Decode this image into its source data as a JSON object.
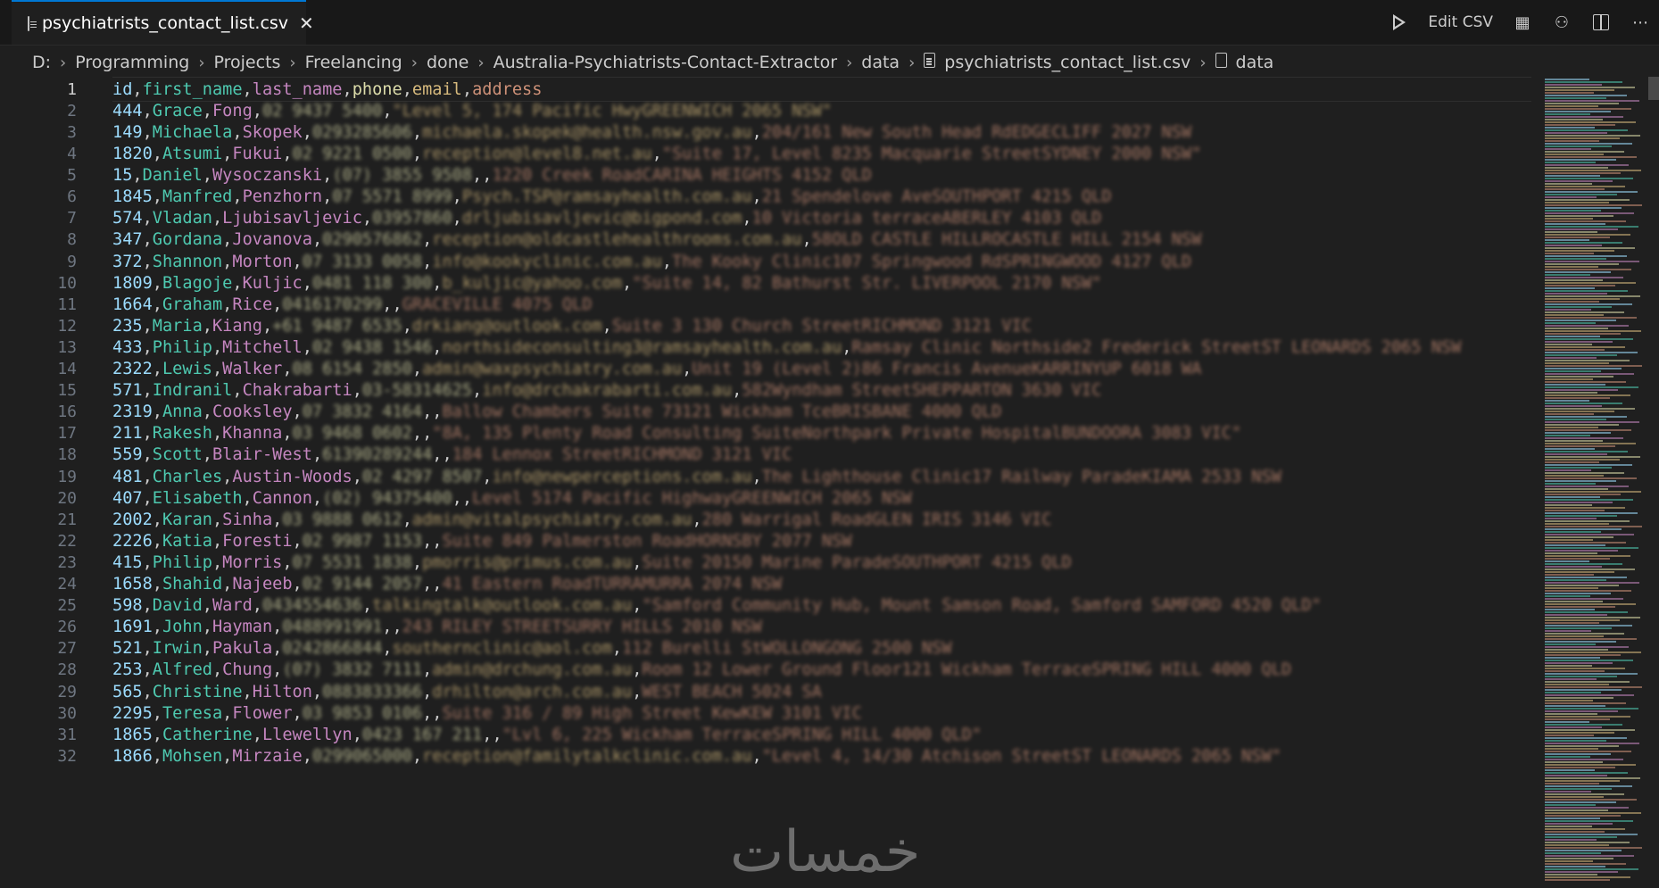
{
  "tab": {
    "title": "psychiatrists_contact_list.csv",
    "close": "✕"
  },
  "toolbar": {
    "edit_csv": "Edit CSV"
  },
  "breadcrumb": [
    "D:",
    "Programming",
    "Projects",
    "Freelancing",
    "done",
    "Australia-Psychiatrists-Contact-Extractor",
    "data",
    "psychiatrists_contact_list.csv",
    "data"
  ],
  "lines": [
    {
      "n": "1",
      "fields": [
        "id",
        "first_name",
        "last_name",
        "phone",
        "email",
        "address"
      ]
    },
    {
      "n": "2",
      "fields": [
        "444",
        "Grace",
        "Fong",
        "02 9437 5400",
        "\"Level 5, 174 Pacific HwyGREENWICH 2065 NSW\""
      ]
    },
    {
      "n": "3",
      "fields": [
        "149",
        "Michaela",
        "Skopek",
        "0293285606",
        "michaela.skopek@health.nsw.gov.au",
        "204/161 New South Head RdEDGECLIFF 2027 NSW"
      ]
    },
    {
      "n": "4",
      "fields": [
        "1820",
        "Atsumi",
        "Fukui",
        "02 9221 0500",
        "reception@level8.net.au",
        "\"Suite 17, Level 8235 Macquarie StreetSYDNEY 2000 NSW\""
      ]
    },
    {
      "n": "5",
      "fields": [
        "15",
        "Daniel",
        "Wysoczanski",
        "(07) 3855 9508",
        "",
        "1220 Creek RoadCARINA HEIGHTS 4152 QLD"
      ]
    },
    {
      "n": "6",
      "fields": [
        "1845",
        "Manfred",
        "Penzhorn",
        "07 5571 8999",
        "Psych.TSP@ramsayhealth.com.au",
        "21 Spendelove AveSOUTHPORT 4215 QLD"
      ]
    },
    {
      "n": "7",
      "fields": [
        "574",
        "Vladan",
        "Ljubisavljevic",
        "03957860",
        "drljubisavljevic@bigpond.com",
        "10 Victoria terraceABERLEY 4103 QLD"
      ]
    },
    {
      "n": "8",
      "fields": [
        "347",
        "Gordana",
        "Jovanova",
        "0290576862",
        "reception@oldcastlehealthrooms.com.au",
        "58OLD CASTLE HILLROCASTLE HILL 2154 NSW"
      ]
    },
    {
      "n": "9",
      "fields": [
        "372",
        "Shannon",
        "Morton",
        "07 3133 0058",
        "info@kookyclinic.com.au",
        "The Kooky Clinic107 Springwood RdSPRINGWOOD 4127 QLD"
      ]
    },
    {
      "n": "10",
      "fields": [
        "1809",
        "Blagoje",
        "Kuljic",
        "0481 118 300",
        "b_kuljic@yahoo.com",
        "\"Suite 14, 82 Bathurst Str. LIVERPOOL 2170 NSW\""
      ]
    },
    {
      "n": "11",
      "fields": [
        "1664",
        "Graham",
        "Rice",
        "0416170299",
        "",
        "GRACEVILLE 4075 QLD"
      ]
    },
    {
      "n": "12",
      "fields": [
        "235",
        "Maria",
        "Kiang",
        "+61 9487 6535",
        "drkiang@outlook.com",
        "Suite 3 130 Church StreetRICHMOND 3121 VIC"
      ]
    },
    {
      "n": "13",
      "fields": [
        "433",
        "Philip",
        "Mitchell",
        "02 9438 1546",
        "northsideconsulting3@ramsayhealth.com.au",
        "Ramsay Clinic Northside2 Frederick StreetST LEONARDS 2065 NSW"
      ]
    },
    {
      "n": "14",
      "fields": [
        "2322",
        "Lewis",
        "Walker",
        "08 6154 2850",
        "admin@waxpsychiatry.com.au",
        "Unit 19 (Level 2)86 Francis AvenueKARRINYUP 6018 WA"
      ]
    },
    {
      "n": "15",
      "fields": [
        "571",
        "Indranil",
        "Chakrabarti",
        "03-58314625",
        "info@drchakrabarti.com.au",
        "582Wyndham StreetSHEPPARTON 3630 VIC"
      ]
    },
    {
      "n": "16",
      "fields": [
        "2319",
        "Anna",
        "Cooksley",
        "07 3832 4164",
        "",
        "Ballow Chambers Suite 73121 Wickham TceBRISBANE 4000 QLD"
      ]
    },
    {
      "n": "17",
      "fields": [
        "211",
        "Rakesh",
        "Khanna",
        "03 9468 0602",
        "",
        "\"8A, 135 Plenty Road Consulting SuiteNorthpark Private HospitalBUNDOORA 3083 VIC\""
      ]
    },
    {
      "n": "18",
      "fields": [
        "559",
        "Scott",
        "Blair-West",
        "61390289244",
        "",
        "184 Lennox StreetRICHMOND 3121 VIC"
      ]
    },
    {
      "n": "19",
      "fields": [
        "481",
        "Charles",
        "Austin-Woods",
        "02 4297 8507",
        "info@newperceptions.com.au",
        "The Lighthouse Clinic17 Railway ParadeKIAMA 2533 NSW"
      ]
    },
    {
      "n": "20",
      "fields": [
        "407",
        "Elisabeth",
        "Cannon",
        "(02) 94375400",
        "",
        "Level 5174 Pacific HighwayGREENWICH 2065 NSW"
      ]
    },
    {
      "n": "21",
      "fields": [
        "2002",
        "Karan",
        "Sinha",
        "03 9888 0612",
        "admin@vitalpsychiatry.com.au",
        "280 Warrigal RoadGLEN IRIS 3146 VIC"
      ]
    },
    {
      "n": "22",
      "fields": [
        "2226",
        "Katia",
        "Foresti",
        "02 9987 1153",
        "",
        "Suite 849 Palmerston RoadHORNSBY 2077 NSW"
      ]
    },
    {
      "n": "23",
      "fields": [
        "415",
        "Philip",
        "Morris",
        "07 5531 1838",
        "pmorris@primus.com.au",
        "Suite 20150 Marine ParadeSOUTHPORT 4215 QLD"
      ]
    },
    {
      "n": "24",
      "fields": [
        "1658",
        "Shahid",
        "Najeeb",
        "02 9144 2057",
        "",
        "41 Eastern RoadTURRAMURRA 2074 NSW"
      ]
    },
    {
      "n": "25",
      "fields": [
        "598",
        "David",
        "Ward",
        "0434554636",
        "talkingtalk@outlook.com.au",
        "\"Samford Community Hub, Mount Samson Road, Samford SAMFORD 4520 QLD\""
      ]
    },
    {
      "n": "26",
      "fields": [
        "1691",
        "John",
        "Hayman",
        "0488991991",
        "",
        "243 RILEY STREETSURRY HILLS 2010 NSW"
      ]
    },
    {
      "n": "27",
      "fields": [
        "521",
        "Irwin",
        "Pakula",
        "0242866844",
        "southernclinic@aol.com",
        "112 Burelli StWOLLONGONG 2500 NSW"
      ]
    },
    {
      "n": "28",
      "fields": [
        "253",
        "Alfred",
        "Chung",
        "(07) 3832 7111",
        "admin@drchung.com.au",
        "Room 12 Lower Ground Floor121 Wickham TerraceSPRING HILL 4000 QLD"
      ]
    },
    {
      "n": "29",
      "fields": [
        "565",
        "Christine",
        "Hilton",
        "0883833366",
        "drhilton@arch.com.au",
        "WEST BEACH 5024 SA"
      ]
    },
    {
      "n": "30",
      "fields": [
        "2295",
        "Teresa",
        "Flower",
        "03 9853 0106",
        "",
        "Suite 316 / 89 High Street KewKEW 3101 VIC"
      ]
    },
    {
      "n": "31",
      "fields": [
        "1865",
        "Catherine",
        "Llewellyn",
        "0423 167 211",
        "",
        "\"Lvl 6, 225 Wickham TerraceSPRING HILL 4000 QLD\""
      ]
    },
    {
      "n": "32",
      "fields": [
        "1866",
        "Mohsen",
        "Mirzaie",
        "0299065000",
        "reception@familytalkclinic.com.au",
        "\"Level 4, 14/30 Atchison StreetST LEONARDS 2065 NSW\""
      ]
    }
  ],
  "watermark": "خمسات",
  "colors": {
    "background": "#1f1f1f",
    "tab_accent": "#0078d4"
  }
}
